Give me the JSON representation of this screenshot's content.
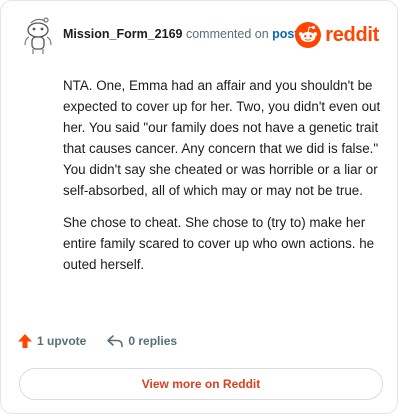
{
  "comment": {
    "author": "Mission_Form_2169",
    "action_text": "commented on",
    "post_link_label": "post",
    "paragraphs": [
      "NTA. One, Emma had an affair and you shouldn't be expected to cover up for her. Two, you didn't even out her. You said \"our family does not have a genetic trait that causes cancer. Any concern that we did is false.\" You didn't say she cheated or was horrible or a liar or self-absorbed, all of which may or may not be true.",
      "She chose to cheat. She chose to (try to) make her entire family scared to cover up who own actions. he outed herself."
    ]
  },
  "brand": {
    "wordmark": "reddit",
    "color": "#ff4500"
  },
  "actions": {
    "upvote_label": "1 upvote",
    "replies_label": "0 replies",
    "upvote_icon": "upvote-arrow-icon",
    "reply_icon": "reply-arrow-icon"
  },
  "footer": {
    "view_more_label": "View more on Reddit"
  }
}
